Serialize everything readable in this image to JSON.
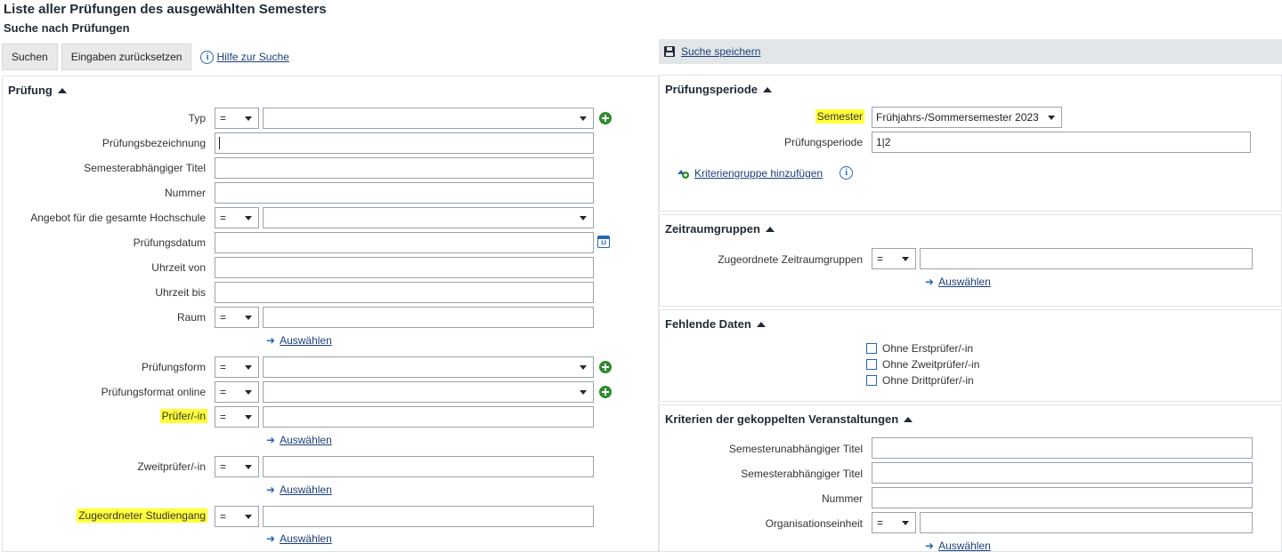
{
  "page": {
    "title": "Liste aller Prüfungen des ausgewählten Semesters",
    "subtitle": "Suche nach Prüfungen"
  },
  "toolbar": {
    "search_label": "Suchen",
    "reset_label": "Eingaben zurücksetzen",
    "help_label": "Hilfe zur Suche",
    "save_search_label": "Suche speichern"
  },
  "pruefung": {
    "heading": "Prüfung",
    "typ_label": "Typ",
    "typ_op": "=",
    "typ_value": "",
    "bezeichnung_label": "Prüfungsbezeichnung",
    "semtitel_label": "Semesterabhängiger Titel",
    "nummer_label": "Nummer",
    "angebot_label": "Angebot für die gesamte Hochschule",
    "angebot_op": "=",
    "datum_label": "Prüfungsdatum",
    "calendar_text": "12",
    "zeit_von_label": "Uhrzeit von",
    "zeit_bis_label": "Uhrzeit bis",
    "raum_label": "Raum",
    "raum_op": "=",
    "form_label": "Prüfungsform",
    "form_op": "=",
    "format_label": "Prüfungsformat online",
    "format_op": "=",
    "pruefer_label": "Prüfer/-in",
    "pruefer_op": "=",
    "zweitpruefer_label": "Zweitprüfer/-in",
    "zweitpruefer_op": "=",
    "studiengang_label": "Zugeordneter Studiengang",
    "studiengang_op": "=",
    "auswaehlen": "Auswählen"
  },
  "periode": {
    "heading": "Prüfungsperiode",
    "semester_label": "Semester",
    "semester_value": "Frühjahrs-/Sommersemester 2023",
    "periode_label": "Prüfungsperiode",
    "periode_value": "1|2",
    "kriterien_link": "Kriteriengruppe hinzufügen"
  },
  "zeitraum": {
    "heading": "Zeitraumgruppen",
    "label": "Zugeordnete Zeitraumgruppen",
    "op": "=",
    "auswaehlen": "Auswählen"
  },
  "fehlend": {
    "heading": "Fehlende Daten",
    "options": [
      "Ohne Erstprüfer/-in",
      "Ohne Zweitprüfer/-in",
      "Ohne Drittprüfer/-in"
    ]
  },
  "gekoppelt": {
    "heading": "Kriterien der gekoppelten Veranstaltungen",
    "semunabh_label": "Semesterunabhängiger Titel",
    "semabh_label": "Semesterabhängiger Titel",
    "nummer_label": "Nummer",
    "org_label": "Organisationseinheit",
    "org_op": "=",
    "auswaehlen": "Auswählen"
  },
  "colors": {
    "highlight": "#ffff3a",
    "link": "#1b3f7a",
    "info": "#2566b3",
    "plus": "#2e8b2e"
  }
}
